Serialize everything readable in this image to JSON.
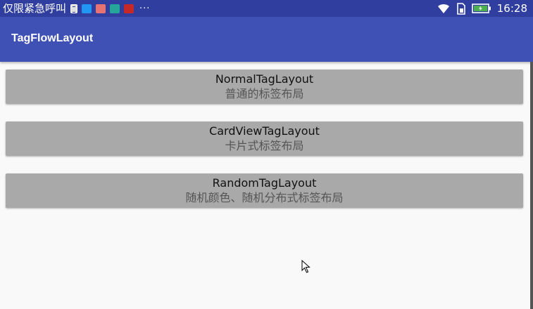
{
  "status_bar": {
    "carrier": "仅限紧急呼叫",
    "notification_icons": [
      "notes-icon",
      "app-icon",
      "gift-icon",
      "chat-icon",
      "huawei-icon"
    ],
    "overflow": "···",
    "time": "16:28"
  },
  "app_bar": {
    "title": "TagFlowLayout"
  },
  "items": [
    {
      "title": "NormalTagLayout",
      "subtitle": "普通的标签布局"
    },
    {
      "title": "CardViewTagLayout",
      "subtitle": "卡片式标签布局"
    },
    {
      "title": "RandomTagLayout",
      "subtitle": "随机颜色、随机分布式标签布局"
    }
  ],
  "colors": {
    "status_bar": "#303f9f",
    "app_bar": "#3f51b5",
    "button": "#a9a9a9",
    "background": "#f9f9f9"
  }
}
